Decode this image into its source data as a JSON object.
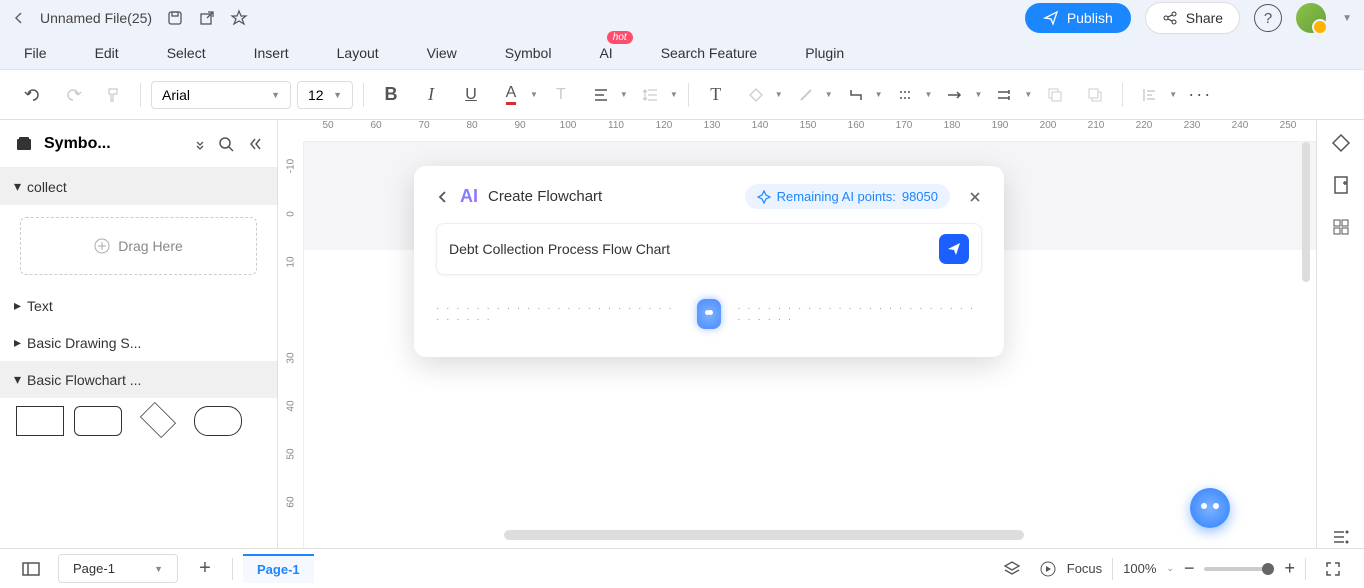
{
  "titlebar": {
    "filename": "Unnamed File(25)",
    "publish": "Publish",
    "share": "Share"
  },
  "menubar": {
    "items": [
      "File",
      "Edit",
      "Select",
      "Insert",
      "Layout",
      "View",
      "Symbol",
      "AI",
      "Search Feature",
      "Plugin"
    ],
    "hot_badge": "hot"
  },
  "toolbar": {
    "font": "Arial",
    "size": "12"
  },
  "left_panel": {
    "title": "Symbo...",
    "sections": {
      "collect": "collect",
      "drag_here": "Drag Here",
      "text": "Text",
      "basic_drawing": "Basic Drawing S...",
      "basic_flowchart": "Basic Flowchart ..."
    }
  },
  "ruler_h": [
    "50",
    "60",
    "70",
    "80",
    "90",
    "100",
    "110",
    "120",
    "130",
    "140",
    "150",
    "160",
    "170",
    "180",
    "190",
    "200",
    "210",
    "220",
    "230",
    "240",
    "250"
  ],
  "ruler_v": [
    "-10",
    "0",
    "10",
    "",
    "30",
    "40",
    "50",
    "60"
  ],
  "ai_dialog": {
    "title": "Create Flowchart",
    "points_label": "Remaining AI points: ",
    "points_value": "98050",
    "input_value": "Debt Collection Process Flow Chart"
  },
  "bottombar": {
    "page_dropdown": "Page-1",
    "active_page": "Page-1",
    "focus": "Focus",
    "zoom": "100%"
  }
}
